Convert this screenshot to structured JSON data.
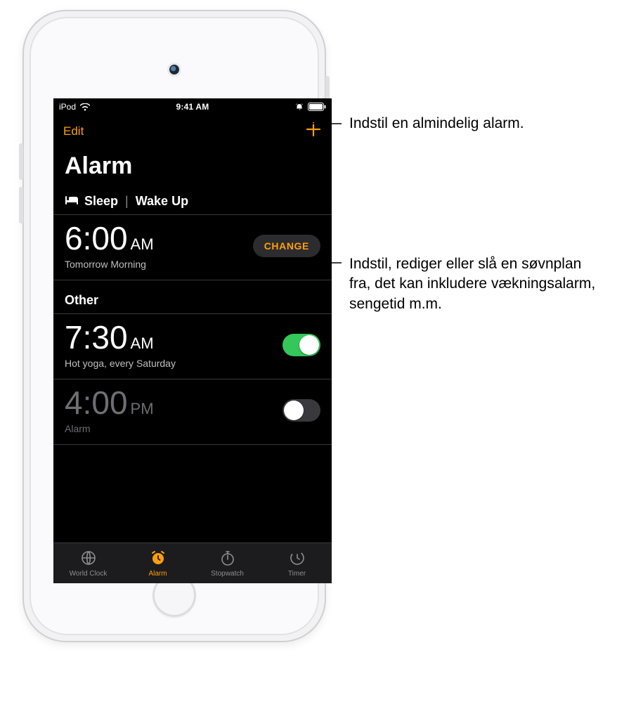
{
  "status": {
    "carrier": "iPod",
    "time": "9:41 AM"
  },
  "navbar": {
    "edit": "Edit",
    "add_icon": "plus-icon"
  },
  "title": "Alarm",
  "sleep_section": {
    "bed_icon": "bed-icon",
    "label_sleep": "Sleep",
    "sep": "|",
    "label_wake": "Wake Up",
    "time": "6:00",
    "ampm": "AM",
    "sub": "Tomorrow Morning",
    "change": "CHANGE"
  },
  "other_section": {
    "header": "Other",
    "alarms": [
      {
        "time": "7:30",
        "ampm": "AM",
        "sub": "Hot yoga, every Saturday",
        "on": true
      },
      {
        "time": "4:00",
        "ampm": "PM",
        "sub": "Alarm",
        "on": false
      }
    ]
  },
  "tabs": {
    "world": "World Clock",
    "alarm": "Alarm",
    "stopwatch": "Stopwatch",
    "timer": "Timer"
  },
  "callouts": {
    "add": "Indstil en almindelig alarm.",
    "change": "Indstil, rediger eller slå en søvnplan fra, det kan inkludere vækningsalarm, sengetid m.m."
  }
}
